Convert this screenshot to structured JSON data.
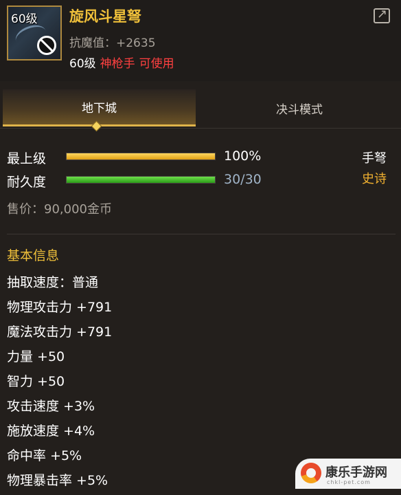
{
  "item": {
    "level_badge": "60级",
    "name": "旋风斗星弩",
    "attribute": "抗魔值：+2635",
    "req_level": "60级",
    "req_class": "神枪手",
    "req_usable": "可使用",
    "type": "手弩",
    "rarity": "史诗",
    "price": "售价：90,000金币",
    "colors": {
      "name": "#f0c03a",
      "rarity": "#f0b030",
      "requirement": "#ff4040"
    }
  },
  "tabs": [
    {
      "label": "地下城",
      "active": true
    },
    {
      "label": "决斗模式",
      "active": false
    }
  ],
  "stats": {
    "level_label": "最上级",
    "level_value": "100%",
    "level_fraction": 1.0,
    "durability_label": "耐久度",
    "durability_value": "30/30",
    "durability_fraction": 1.0
  },
  "basic_info": {
    "title": "基本信息",
    "items": [
      "抽取速度：普通",
      "物理攻击力 +791",
      "魔法攻击力 +791",
      "力量 +50",
      "智力 +50",
      "攻击速度 +3%",
      "施放速度 +4%",
      "命中率 +5%",
      "物理暴击率 +5%"
    ]
  },
  "watermark": {
    "text": "康乐手游网",
    "sub": "chkl-pet.com"
  },
  "icons": {
    "forbid": "forbid-icon",
    "share": "share-icon",
    "crossbow": "crossbow-icon",
    "tab_marker": "diamond-icon"
  }
}
